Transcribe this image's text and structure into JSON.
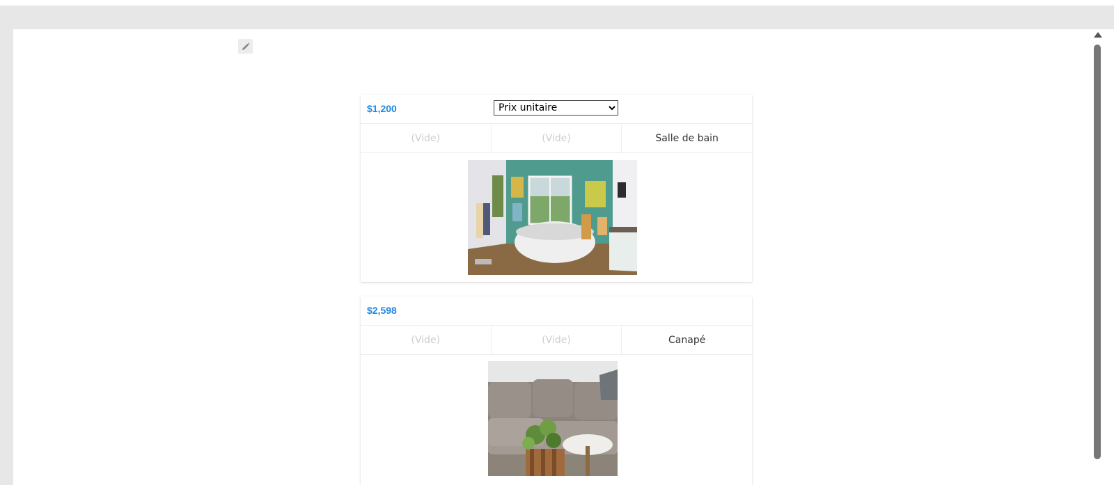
{
  "items": [
    {
      "price": "$1,200",
      "sort_select": {
        "selected": "Prix unitaire"
      },
      "fields": [
        "(Vide)",
        "(Vide)",
        "Salle de bain"
      ],
      "image_subject": "bathroom-with-bathtub"
    },
    {
      "price": "$2,598",
      "fields": [
        "(Vide)",
        "(Vide)",
        "Canapé"
      ],
      "image_subject": "sofa-with-plant"
    }
  ],
  "icons": {
    "edit": "pencil-icon"
  },
  "colors": {
    "price": "#1e88e5",
    "empty_text": "#cdcdcd",
    "text": "#333333"
  }
}
